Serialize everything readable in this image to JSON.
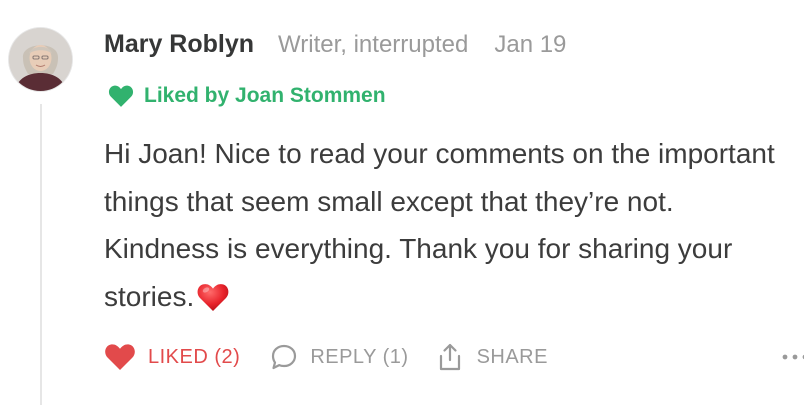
{
  "comment": {
    "author": "Mary Roblyn",
    "subtitle": "Writer, interrupted",
    "date": "Jan 19",
    "liked_by": "Liked by Joan Stommen",
    "body": "Hi Joan! Nice to read your comments on the important things that seem small except that they’re not. Kindness is everything. Thank you for sharing your stories."
  },
  "actions": {
    "like_label": "LIKED (2)",
    "reply_label": "REPLY (1)",
    "share_label": "SHARE"
  },
  "icons": {
    "liked_by": "heart-icon",
    "body_emoji": "red-heart-emoji-icon",
    "like": "heart-icon",
    "reply": "speech-bubble-icon",
    "share": "share-icon",
    "more": "ellipsis-icon"
  },
  "colors": {
    "liked_by_green": "#31b26e",
    "like_red": "#e24a4b",
    "muted_gray": "#9a9a9a",
    "text": "#3c3c3c"
  }
}
